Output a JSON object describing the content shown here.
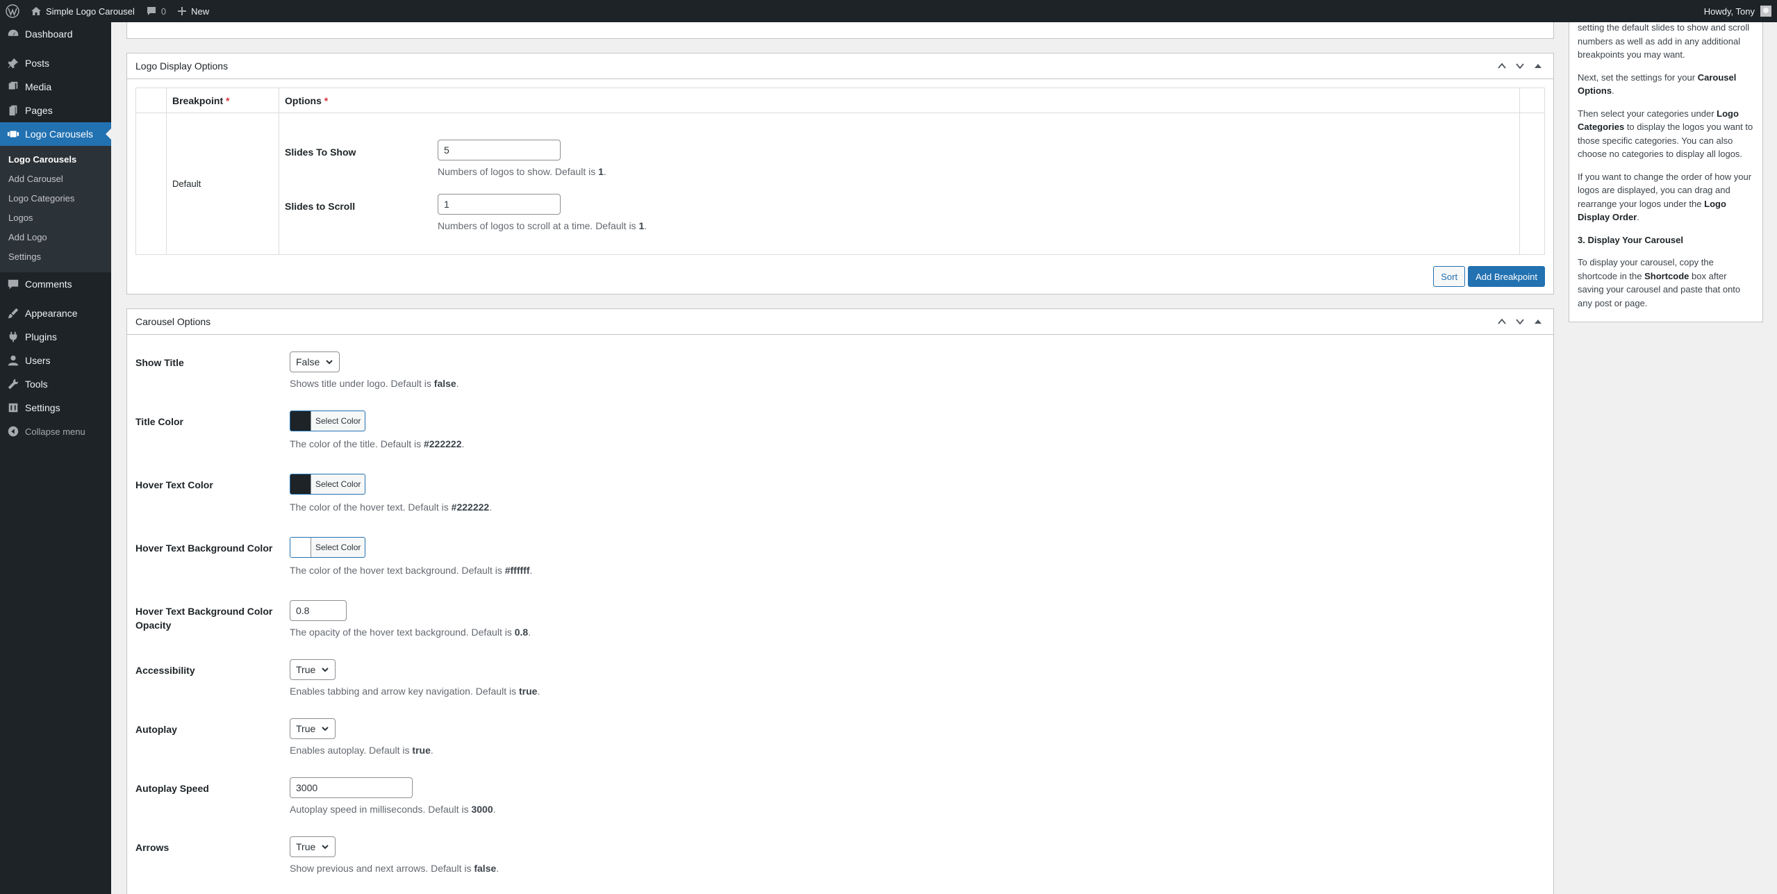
{
  "adminbar": {
    "site_name": "Simple Logo Carousel",
    "comments_count": "0",
    "new_label": "New",
    "howdy": "Howdy, Tony"
  },
  "menu": {
    "dashboard": "Dashboard",
    "posts": "Posts",
    "media": "Media",
    "pages": "Pages",
    "logo_carousels": "Logo Carousels",
    "submenu": [
      "Logo Carousels",
      "Add Carousel",
      "Logo Categories",
      "Logos",
      "Add Logo",
      "Settings"
    ],
    "comments": "Comments",
    "appearance": "Appearance",
    "plugins": "Plugins",
    "users": "Users",
    "tools": "Tools",
    "settings": "Settings",
    "collapse": "Collapse menu"
  },
  "logo_display": {
    "title": "Logo Display Options",
    "col_breakpoint": "Breakpoint",
    "col_options": "Options",
    "required_mark": "*",
    "row_label": "Default",
    "slides_to_show": {
      "label": "Slides To Show",
      "value": "5",
      "desc": "Numbers of logos to show. Default is ",
      "default": "1",
      "suffix": "."
    },
    "slides_to_scroll": {
      "label": "Slides to Scroll",
      "value": "1",
      "desc": "Numbers of logos to scroll at a time. Default is ",
      "default": "1",
      "suffix": "."
    },
    "sort_label": "Sort",
    "add_breakpoint_label": "Add Breakpoint"
  },
  "carousel_options": {
    "title": "Carousel Options",
    "select_color_label": "Select Color",
    "show_title": {
      "label": "Show Title",
      "value": "False",
      "desc": "Shows title under logo. Default is ",
      "default": "false",
      "suffix": "."
    },
    "title_color": {
      "label": "Title Color",
      "color": "#1d2327",
      "desc": "The color of the title. Default is ",
      "default": "#222222",
      "suffix": "."
    },
    "hover_text_color": {
      "label": "Hover Text Color",
      "color": "#1d2327",
      "desc": "The color of the hover text. Default is ",
      "default": "#222222",
      "suffix": "."
    },
    "hover_bg_color": {
      "label": "Hover Text Background Color",
      "color": "#ffffff",
      "desc": "The color of the hover text background. Default is ",
      "default": "#ffffff",
      "suffix": "."
    },
    "hover_bg_opacity": {
      "label": "Hover Text Background Color Opacity",
      "value": "0.8",
      "desc": "The opacity of the hover text background. Default is ",
      "default": "0.8",
      "suffix": "."
    },
    "accessibility": {
      "label": "Accessibility",
      "value": "True",
      "desc": "Enables tabbing and arrow key navigation. Default is ",
      "default": "true",
      "suffix": "."
    },
    "autoplay": {
      "label": "Autoplay",
      "value": "True",
      "desc": "Enables autoplay. Default is ",
      "default": "true",
      "suffix": "."
    },
    "autoplay_speed": {
      "label": "Autoplay Speed",
      "value": "3000",
      "desc": "Autoplay speed in milliseconds. Default is ",
      "default": "3000",
      "suffix": "."
    },
    "arrows": {
      "label": "Arrows",
      "value": "True",
      "desc": "Show previous and next arrows. Default is ",
      "default": "false",
      "suffix": "."
    }
  },
  "help": {
    "p1": "setting the default slides to show and scroll numbers as well as add in any additional breakpoints you may want.",
    "p2_a": "Next, set the settings for your ",
    "p2_b": "Carousel Options",
    "p2_c": ".",
    "p3_a": "Then select your categories under ",
    "p3_b": "Logo Categories",
    "p3_c": " to display the logos you want to those specific categories. You can also choose no categories to display all logos.",
    "p4_a": "If you want to change the order of how your logos are displayed, you can drag and rearrange your logos under the ",
    "p4_b": "Logo Display Order",
    "p4_c": ".",
    "h3": "3. Display Your Carousel",
    "p5_a": "To display your carousel, copy the shortcode in the ",
    "p5_b": "Shortcode",
    "p5_c": " box after saving your carousel and paste that onto any post or page."
  },
  "colors": {
    "accent": "#2271b1",
    "admin_dark": "#1d2327",
    "submenu_bg": "#2c3338",
    "required": "#d63638"
  }
}
